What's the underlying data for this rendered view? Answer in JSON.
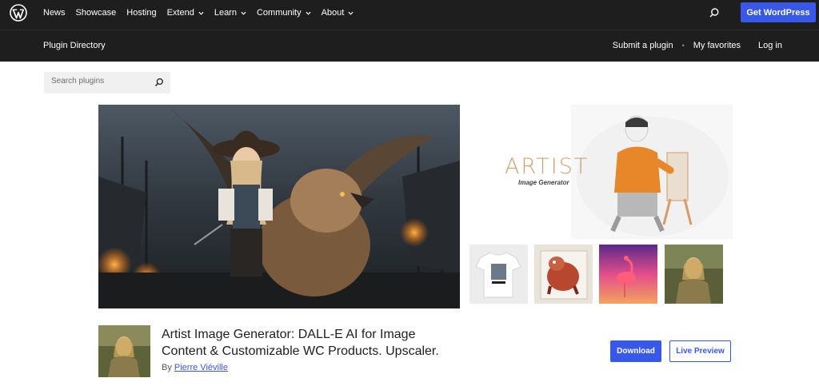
{
  "topbar": {
    "logo_icon": "wordpress-logo-icon",
    "nav": [
      {
        "label": "News",
        "has_dropdown": false
      },
      {
        "label": "Showcase",
        "has_dropdown": false
      },
      {
        "label": "Hosting",
        "has_dropdown": false
      },
      {
        "label": "Extend",
        "has_dropdown": true
      },
      {
        "label": "Learn",
        "has_dropdown": true
      },
      {
        "label": "Community",
        "has_dropdown": true
      },
      {
        "label": "About",
        "has_dropdown": true
      }
    ],
    "search_icon": "search-icon",
    "cta_label": "Get WordPress"
  },
  "subbar": {
    "title": "Plugin Directory",
    "links": [
      "Submit a plugin",
      "My favorites",
      "Log in"
    ]
  },
  "search": {
    "placeholder": "Search plugins"
  },
  "side_art": {
    "logo_text": "ARTIST",
    "logo_sub": "Image Generator"
  },
  "plugin": {
    "title_line1": "Artist Image Generator: DALL-E AI for Image",
    "title_line2": "Content & Customizable WC Products. Upscaler.",
    "by_prefix": "By",
    "author": "Pierre Viéville",
    "download_label": "Download",
    "preview_label": "Live Preview"
  },
  "colors": {
    "bar_bg": "#1e1e1e",
    "accent": "#3858e9",
    "artist_logo": "#d3a171"
  }
}
